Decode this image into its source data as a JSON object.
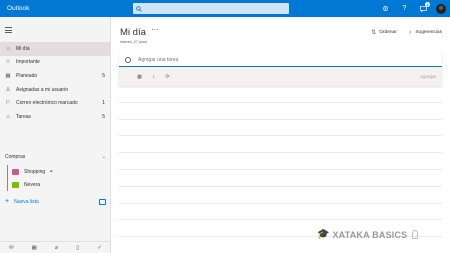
{
  "app": {
    "name": "Outlook"
  },
  "header": {
    "search_placeholder": "",
    "notification_count": "2",
    "icons": [
      "search-icon",
      "gear-icon",
      "help-icon",
      "chat-icon"
    ]
  },
  "sidebar": {
    "items": [
      {
        "label": "Mi día",
        "count": "",
        "icon": "sun-icon",
        "active": true
      },
      {
        "label": "Importante",
        "count": "",
        "icon": "star-icon"
      },
      {
        "label": "Planeado",
        "count": "5",
        "icon": "calendar-icon"
      },
      {
        "label": "Asignadas a mi usuario",
        "count": "",
        "icon": "person-icon"
      },
      {
        "label": "Correo electrónico marcado",
        "count": "1",
        "icon": "flag-icon"
      },
      {
        "label": "Tareas",
        "count": "5",
        "icon": "home-icon"
      }
    ],
    "group": {
      "label": "Compras"
    },
    "lists": [
      {
        "label": "Shopping",
        "icon": "shopping-list-icon"
      },
      {
        "label": "Nevera",
        "icon": "fridge-list-icon"
      }
    ],
    "new_list_label": "Nueva lista",
    "bottom_icons": [
      "mail-icon",
      "calendar-icon",
      "attach-icon",
      "files-icon",
      "todo-icon"
    ]
  },
  "main": {
    "title": "Mi día",
    "more_label": "···",
    "date": "martes, 27 junio",
    "sort_label": "Ordenar",
    "suggestions_label": "Sugerencias",
    "add_task_placeholder": "Agregar una tarea",
    "add_button_label": "Agregar"
  },
  "watermark": {
    "text": "XATAKA BASICS"
  },
  "colors": {
    "brand": "#0078d4",
    "sidebar_bg": "#f4f4f4",
    "active_item": "#e1dfdd"
  }
}
